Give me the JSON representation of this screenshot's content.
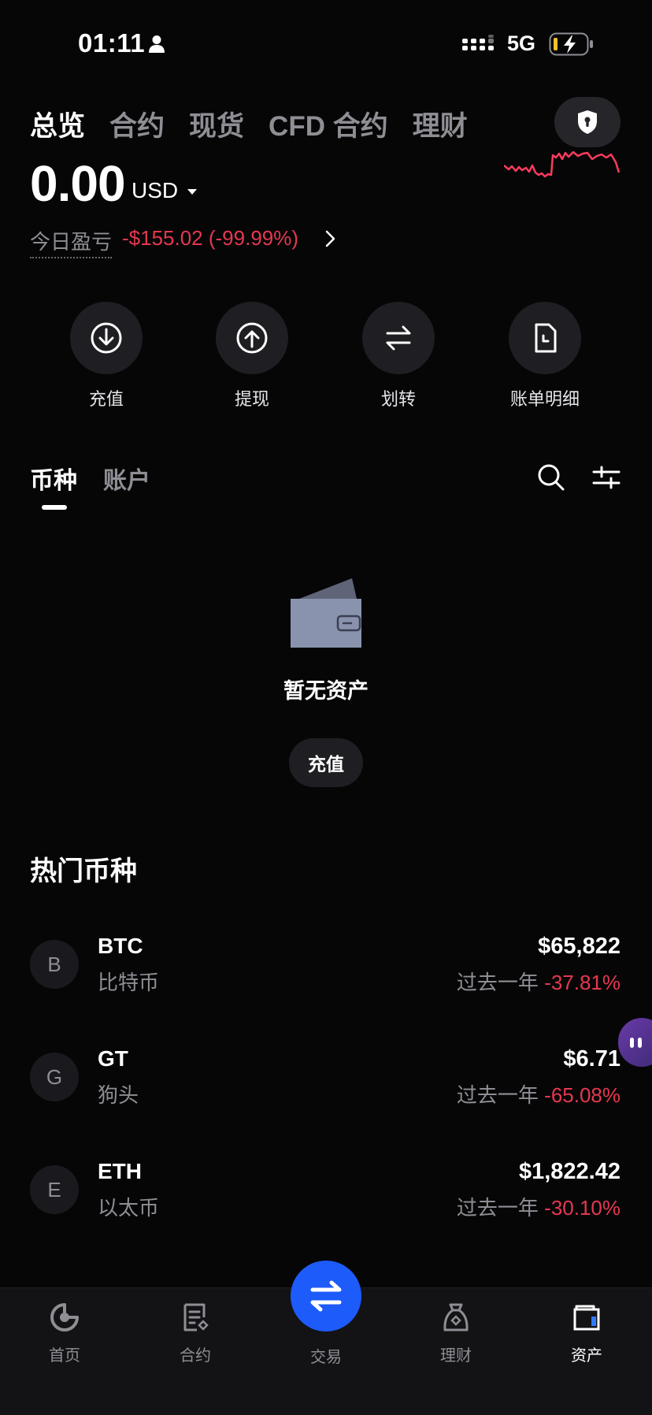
{
  "status_bar": {
    "time": "01:11",
    "network": "5G"
  },
  "top_tabs": [
    "总览",
    "合约",
    "现货",
    "CFD 合约",
    "理财"
  ],
  "balance": {
    "amount": "0.00",
    "currency": "USD",
    "pnl_label": "今日盈亏",
    "pnl_value": "-$155.02 (-99.99%)"
  },
  "actions": [
    {
      "label": "充值",
      "icon": "download-icon"
    },
    {
      "label": "提现",
      "icon": "upload-icon"
    },
    {
      "label": "划转",
      "icon": "transfer-icon"
    },
    {
      "label": "账单明细",
      "icon": "bill-icon"
    }
  ],
  "sub_tabs": [
    "币种",
    "账户"
  ],
  "empty_state": {
    "text": "暂无资产",
    "button": "充值"
  },
  "hot": {
    "title": "热门币种",
    "coins": [
      {
        "letter": "B",
        "symbol": "BTC",
        "name": "比特币",
        "price": "$65,822",
        "period": "过去一年",
        "change": "-37.81%"
      },
      {
        "letter": "G",
        "symbol": "GT",
        "name": "狗头",
        "price": "$6.71",
        "period": "过去一年",
        "change": "-65.08%"
      },
      {
        "letter": "E",
        "symbol": "ETH",
        "name": "以太币",
        "price": "$1,822.42",
        "period": "过去一年",
        "change": "-30.10%"
      }
    ]
  },
  "bottom_nav": [
    "首页",
    "合约",
    "交易",
    "理财",
    "资产"
  ],
  "colors": {
    "background": "#060607",
    "negative": "#e5384f",
    "accent_blue": "#1d5bfa",
    "muted": "#8e8e94"
  }
}
